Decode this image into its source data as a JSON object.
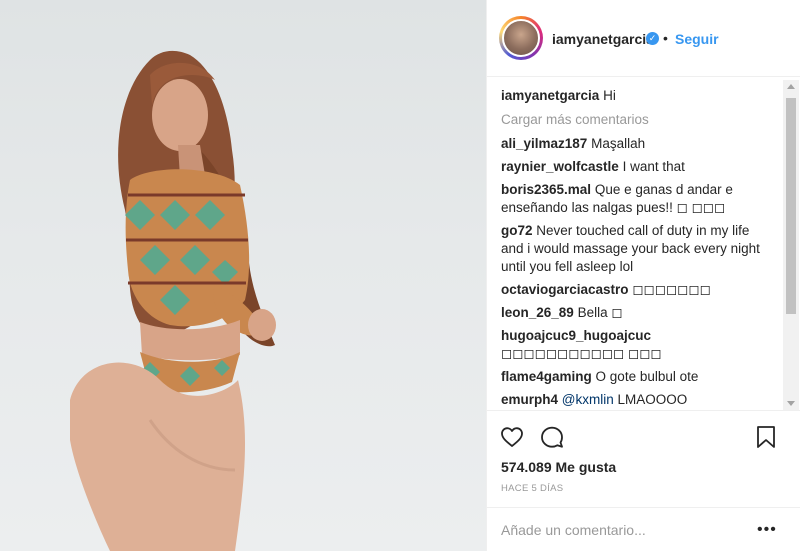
{
  "header": {
    "username": "iamyanetgarcia",
    "verified_glyph": "✓",
    "separator": "•",
    "follow_label": "Seguir"
  },
  "caption": {
    "username": "iamyanetgarcia",
    "text": "Hi"
  },
  "load_more_label": "Cargar más comentarios",
  "comments": [
    {
      "username": "ali_yilmaz187",
      "text": "Maşallah"
    },
    {
      "username": "raynier_wolfcastle",
      "text": "I want that"
    },
    {
      "username": "boris2365.mal",
      "text": "Que e ganas d andar e enseñando las nalgas pues!! ◻ ◻◻◻"
    },
    {
      "username": "go72",
      "text": "Never touched call of duty in my life and i would massage your back every night until you fell asleep lol"
    },
    {
      "username": "octaviogarciacastro",
      "text": "◻◻◻◻◻◻◻"
    },
    {
      "username": "leon_26_89",
      "text": "Bella ◻"
    },
    {
      "username": "hugoajcuc9_hugoajcuc",
      "text": "◻◻◻◻◻◻◻◻◻◻◻ ◻◻◻"
    },
    {
      "username": "flame4gaming",
      "text": "O gote bulbul ote"
    },
    {
      "username": "emurph4",
      "mention": "@kxmlin",
      "text": "LMAOOOO"
    }
  ],
  "likes_label": "574.089 Me gusta",
  "time_label": "HACE 5 DÍAS",
  "add_comment": {
    "placeholder": "Añade un comentario...",
    "more_glyph": "•••"
  },
  "icons": {
    "like": "heart-outline-icon",
    "comment": "comment-bubble-icon",
    "save": "bookmark-icon",
    "more": "more-options-icon",
    "verified": "verified-badge-icon"
  },
  "colors": {
    "link_blue": "#3897f0",
    "text": "#262626",
    "muted": "#999999",
    "border": "#efefef"
  }
}
